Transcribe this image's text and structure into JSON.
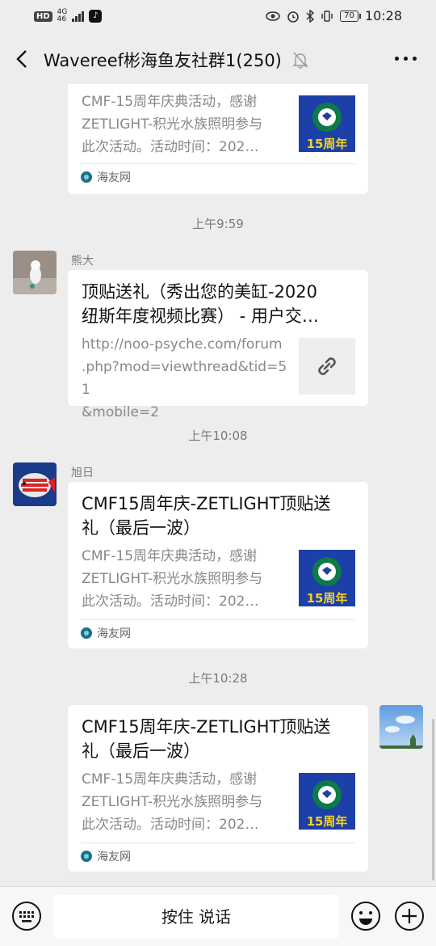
{
  "status": {
    "left": {
      "hd": "HD",
      "network": "4G",
      "network_sub": "46"
    },
    "battery": "70",
    "time": "10:28"
  },
  "header": {
    "title": "Wavereef彬海鱼友社群1(250)"
  },
  "messages": [
    {
      "type": "link-card",
      "desc": "CMF-15周年庆典活动，感谢\nZETLIGHT-积光水族照明参与\n此次活动。活动时间：202…",
      "thumb": "CMF 15周年 logo",
      "source": "海友网"
    },
    {
      "type": "time",
      "text": "上午9:59"
    },
    {
      "type": "link-card",
      "sender": "熊大",
      "title": "顶贴送礼（秀出您的美缸-2020\n纽斯年度视频比赛） - 用户交…",
      "desc": "http://noo-psyche.com/forum\n.php?mod=viewthread&tid=51\n&mobile=2",
      "thumb": "link-icon"
    },
    {
      "type": "time",
      "text": "上午10:08"
    },
    {
      "type": "link-card",
      "sender": "旭日",
      "title": "CMF15周年庆-ZETLIGHT顶贴送\n礼（最后一波）",
      "desc": "CMF-15周年庆典活动，感谢\nZETLIGHT-积光水族照明参与\n此次活动。活动时间：202…",
      "thumb": "CMF 15周年 logo",
      "source": "海友网"
    },
    {
      "type": "time",
      "text": "上午10:28"
    },
    {
      "type": "link-card",
      "self": true,
      "title": "CMF15周年庆-ZETLIGHT顶贴送\n礼（最后一波）",
      "desc": "CMF-15周年庆典活动，感谢\nZETLIGHT-积光水族照明参与\n此次活动。活动时间：202…",
      "thumb": "CMF 15周年 logo",
      "source": "海友网"
    }
  ],
  "input": {
    "hold_to_talk": "按住 说话"
  },
  "thumb_text": "15周年",
  "colors": {
    "background": "#ededed",
    "card": "#ffffff",
    "thumb_blue": "#1d3fa8",
    "thumb_yellow": "#f5d21a",
    "source_icon": "#1f6f8f"
  }
}
